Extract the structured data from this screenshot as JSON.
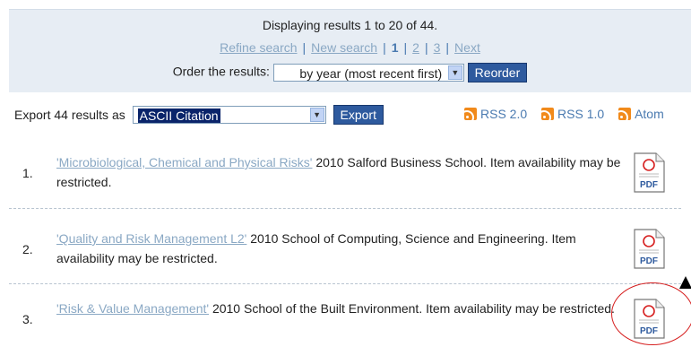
{
  "header": {
    "display_text": "Displaying results 1 to 20 of 44.",
    "refine": "Refine search",
    "new_search": "New search",
    "pages": [
      "1",
      "2",
      "3"
    ],
    "next": "Next",
    "order_label": "Order the results:",
    "order_value": "by year (most recent first)",
    "reorder": "Reorder"
  },
  "export": {
    "label": "Export 44 results as",
    "format": "ASCII Citation",
    "button": "Export",
    "feeds": [
      "RSS 2.0",
      "RSS 1.0",
      "Atom"
    ]
  },
  "results": [
    {
      "num": "1.",
      "title": "'Microbiological, Chemical and Physical Risks'",
      "rest": " 2010 Salford Business School. Item availability may be restricted."
    },
    {
      "num": "2.",
      "title": "'Quality and Risk Management L2'",
      "rest": " 2010 School of Computing, Science and Engineering. Item availability may be restricted."
    },
    {
      "num": "3.",
      "title": "'Risk & Value Management'",
      "rest": " 2010 School of the Built Environment. Item availability may be restricted."
    }
  ],
  "pdf_label": "PDF",
  "colors": {
    "link": "#8aa8c4",
    "button": "#2e5a9e",
    "highlight": "#d61f1f",
    "rss": "#f18a1b"
  }
}
